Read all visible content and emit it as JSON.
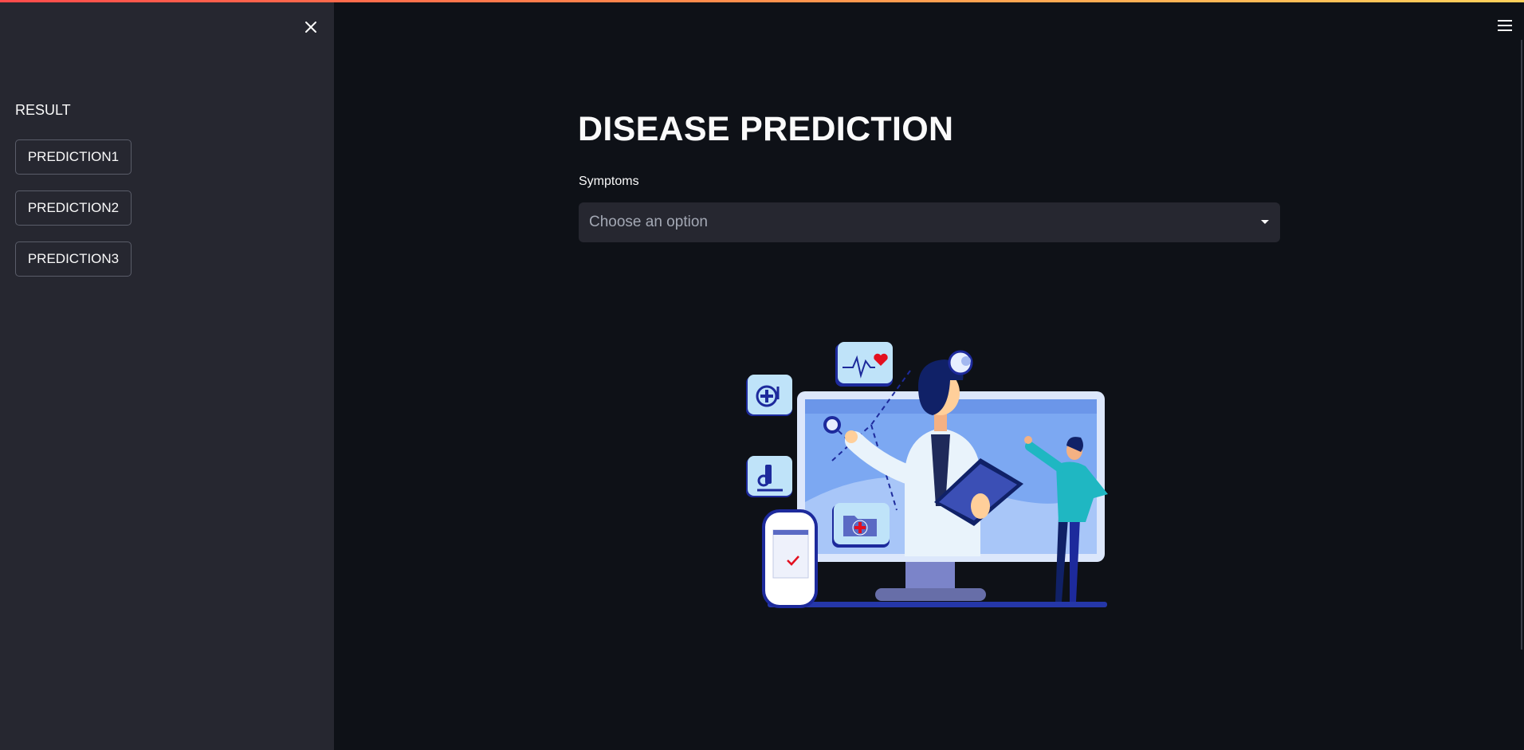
{
  "sidebar": {
    "heading": "RESULT",
    "buttons": [
      "PREDICTION1",
      "PREDICTION2",
      "PREDICTION3"
    ]
  },
  "main": {
    "title": "DISEASE PREDICTION",
    "symptoms": {
      "label": "Symptoms",
      "placeholder": "Choose an option"
    }
  },
  "icons": {
    "close": "close-icon",
    "menu": "hamburger-menu-icon",
    "dropdown": "chevron-down-icon"
  },
  "colors": {
    "background": "#0e1117",
    "sidebar": "#262730",
    "accent_start": "#ff4b4b",
    "accent_end": "#ffd15b"
  }
}
